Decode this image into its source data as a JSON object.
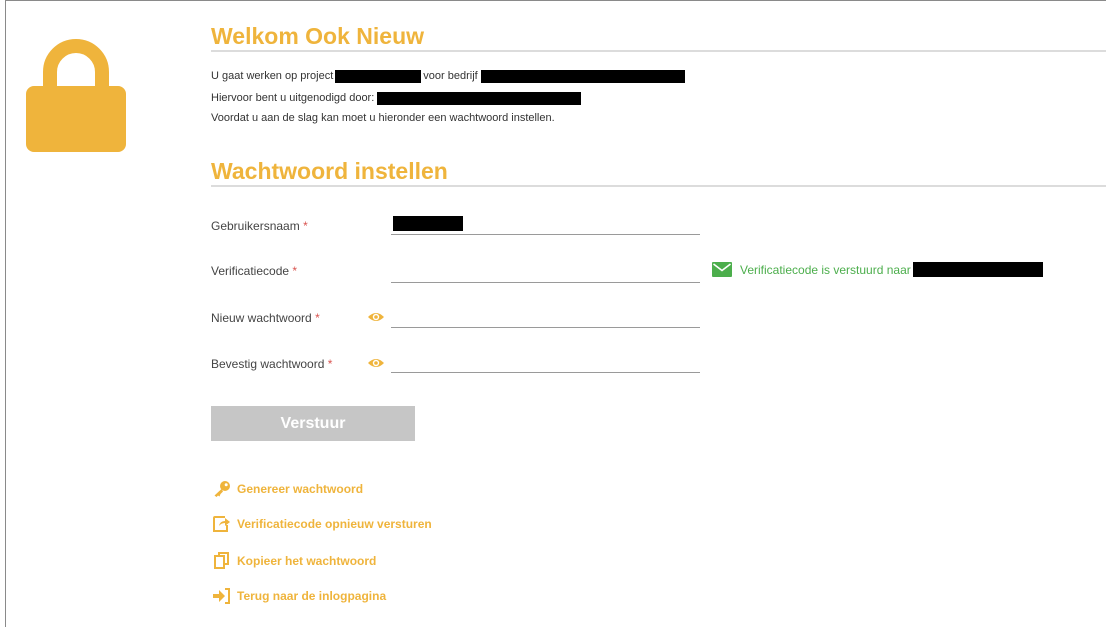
{
  "colors": {
    "accent": "#efb43c",
    "success": "#4cae4c",
    "required": "#d9534f",
    "button_disabled": "#c6c6c6"
  },
  "icons": {
    "lock": "lock-icon",
    "eye": "eye-icon",
    "notice": "envelope-icon",
    "actions": [
      "key-icon",
      "share-icon",
      "copy-icon",
      "sign-in-icon"
    ]
  },
  "welcome": {
    "title": "Welkom Ook Nieuw",
    "project_prefix": "U gaat werken op project",
    "company_prefix": "voor bedrijf",
    "invited_by_prefix": "Hiervoor bent u uitgenodigd door:",
    "instruction": "Voordat u aan de slag kan moet u hieronder een wachtwoord instellen."
  },
  "form": {
    "title": "Wachtwoord instellen",
    "required_marker": "*",
    "username_label": "Gebruikersnaam",
    "verification_label": "Verificatiecode",
    "new_password_label": "Nieuw wachtwoord",
    "confirm_password_label": "Bevestig wachtwoord",
    "verification_notice": "Verificatiecode is verstuurd naar",
    "submit_label": "Verstuur"
  },
  "actions": {
    "generate": "Genereer wachtwoord",
    "resend": "Verificatiecode opnieuw versturen",
    "copy": "Kopieer het wachtwoord",
    "back": "Terug naar de inlogpagina"
  }
}
